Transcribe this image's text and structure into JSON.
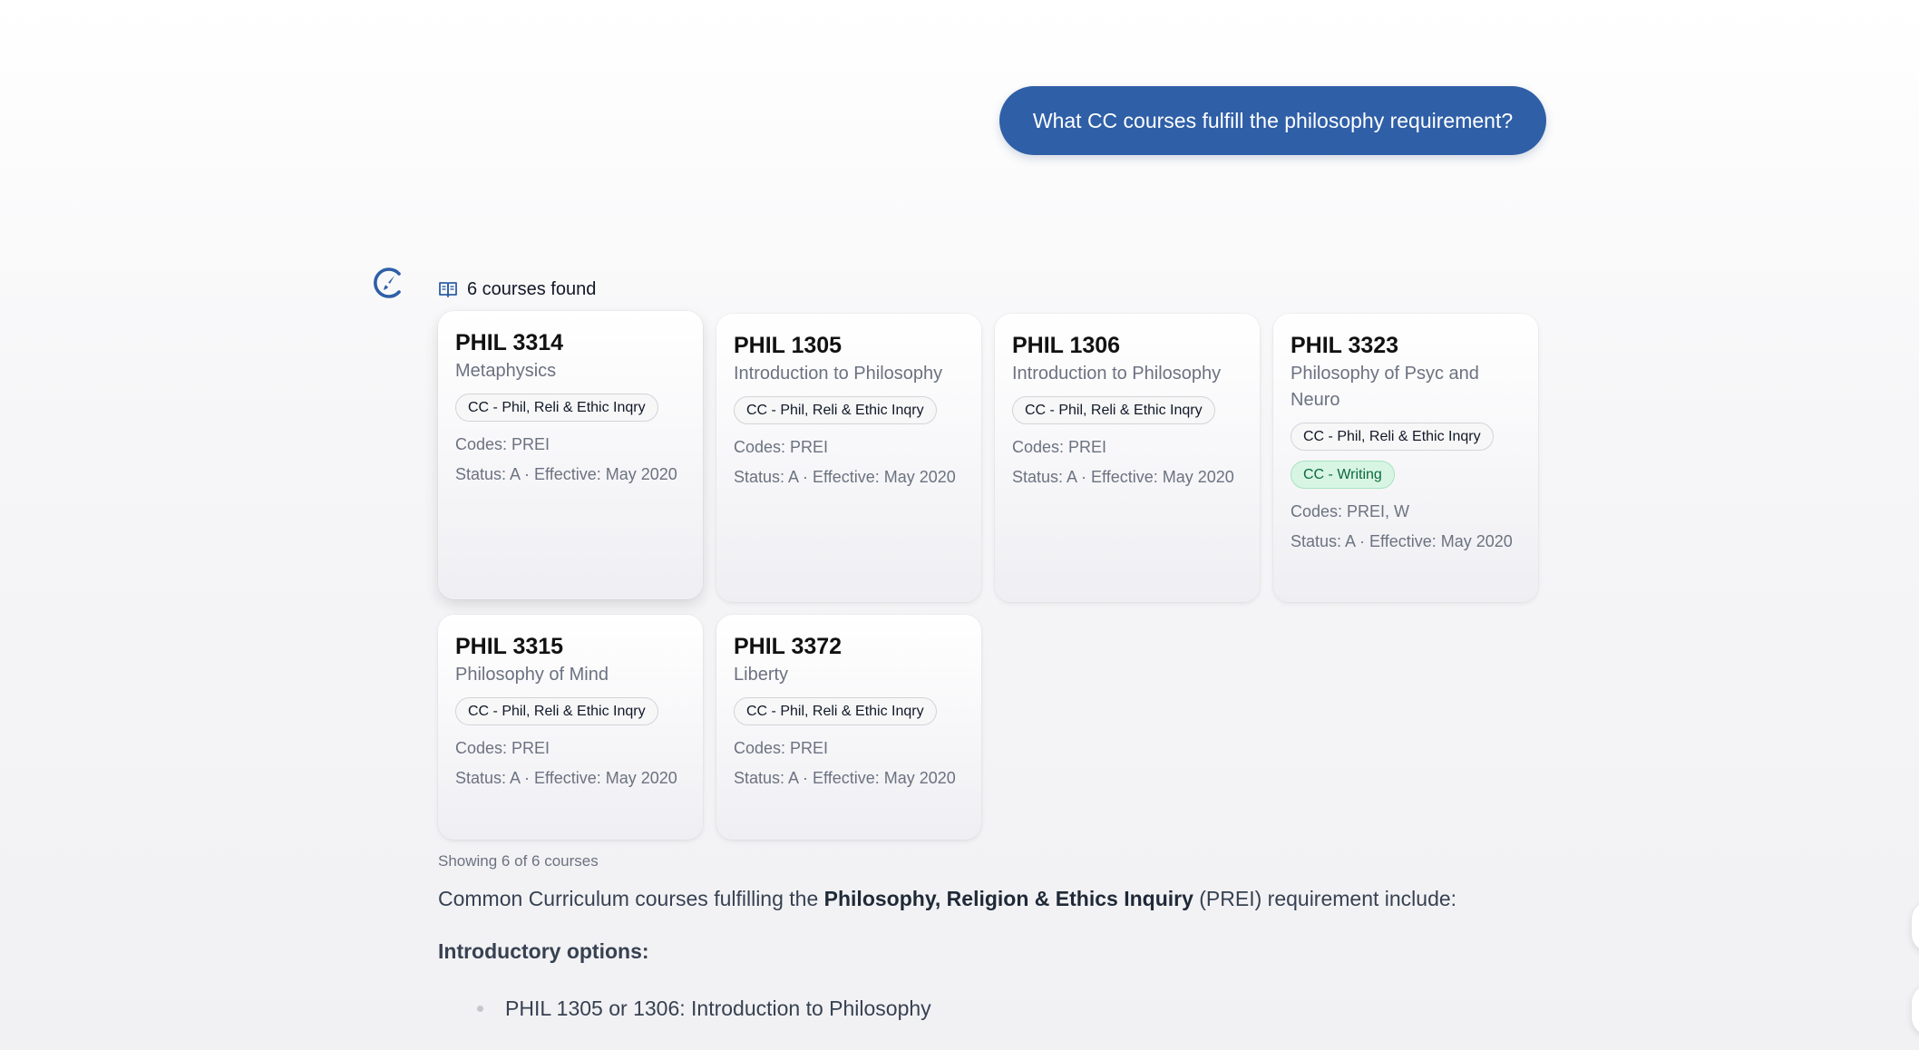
{
  "user_message": "What CC courses fulfill the philosophy requirement?",
  "icons": {
    "assistant": "compass-logo-icon",
    "results": "open-book-icon"
  },
  "colors": {
    "user_bubble": "#2f5fa7",
    "accent": "#2f5fa7",
    "writing_tag_bg": "#d8f5e4",
    "writing_tag_text": "#0b6b3b"
  },
  "results": {
    "header": "6 courses found",
    "showing": "Showing 6 of 6 courses"
  },
  "courses": [
    {
      "code": "PHIL 3314",
      "title": "Metaphysics",
      "tags": [
        {
          "label": "CC - Phil, Reli & Ethic Inqry",
          "style": "default"
        }
      ],
      "codes": "Codes: PREI",
      "status": "Status: A · Effective: May 2020"
    },
    {
      "code": "PHIL 1305",
      "title": "Introduction to Philosophy",
      "tags": [
        {
          "label": "CC - Phil, Reli & Ethic Inqry",
          "style": "default"
        }
      ],
      "codes": "Codes: PREI",
      "status": "Status: A · Effective: May 2020"
    },
    {
      "code": "PHIL 1306",
      "title": "Introduction to Philosophy",
      "tags": [
        {
          "label": "CC - Phil, Reli & Ethic Inqry",
          "style": "default"
        }
      ],
      "codes": "Codes: PREI",
      "status": "Status: A · Effective: May 2020"
    },
    {
      "code": "PHIL 3323",
      "title": "Philosophy of Psyc and Neuro",
      "tags": [
        {
          "label": "CC - Phil, Reli & Ethic Inqry",
          "style": "default"
        },
        {
          "label": "CC - Writing",
          "style": "green"
        }
      ],
      "codes": "Codes: PREI, W",
      "status": "Status: A · Effective: May 2020"
    },
    {
      "code": "PHIL 3315",
      "title": "Philosophy of Mind",
      "tags": [
        {
          "label": "CC - Phil, Reli & Ethic Inqry",
          "style": "default"
        }
      ],
      "codes": "Codes: PREI",
      "status": "Status: A · Effective: May 2020"
    },
    {
      "code": "PHIL 3372",
      "title": "Liberty",
      "tags": [
        {
          "label": "CC - Phil, Reli & Ethic Inqry",
          "style": "default"
        }
      ],
      "codes": "Codes: PREI",
      "status": "Status: A · Effective: May 2020"
    }
  ],
  "answer": {
    "intro_before": "Common Curriculum courses fulfilling the ",
    "intro_bold": "Philosophy, Religion & Ethics Inquiry",
    "intro_after": " (PREI) requirement include:",
    "subheading": "Introductory options:",
    "bullets": [
      "PHIL 1305 or 1306: Introduction to Philosophy"
    ]
  }
}
